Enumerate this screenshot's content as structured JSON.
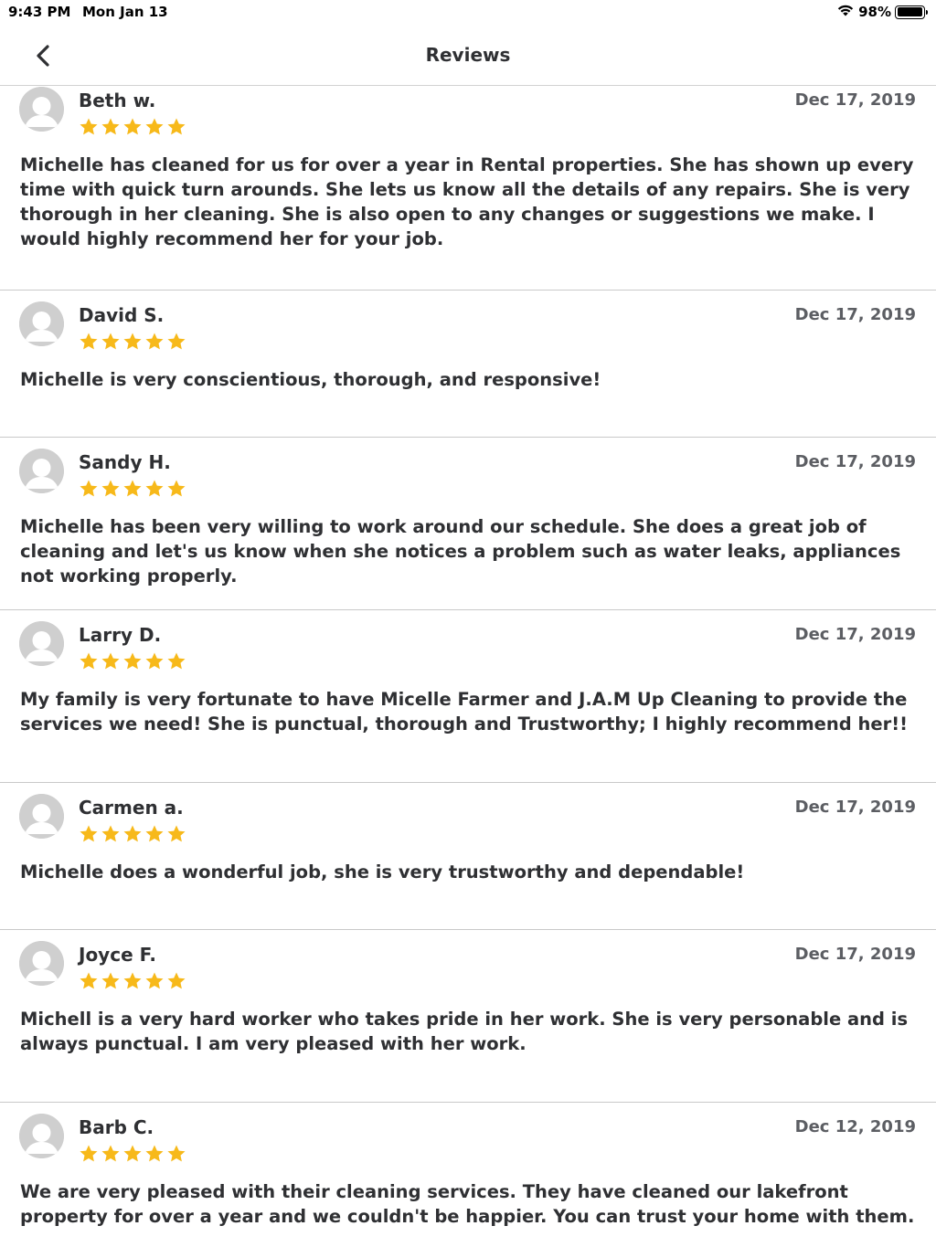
{
  "status_bar": {
    "time": "9:43 PM",
    "date": "Mon Jan 13",
    "battery_percent": "98%",
    "battery_level": 0.98,
    "wifi_icon": "wifi-icon"
  },
  "nav": {
    "title": "Reviews",
    "back_icon": "chevron-left-icon"
  },
  "star_color": "#f7b91a",
  "reviews": [
    {
      "name": "Beth w.",
      "date": "Dec 17, 2019",
      "rating": 5,
      "text": "Michelle has cleaned for us for over a year in Rental properties.  She has shown up every time with quick turn arounds. She lets us know all the details of any repairs.  She is very thorough in her cleaning.  She is also open to any changes or suggestions we make.  I would highly recommend her for your job."
    },
    {
      "name": "David S.",
      "date": "Dec 17, 2019",
      "rating": 5,
      "text": "Michelle is very conscientious, thorough, and responsive!"
    },
    {
      "name": "Sandy H.",
      "date": "Dec 17, 2019",
      "rating": 5,
      "text": "Michelle has been very willing to work around our schedule.  She does a great job of cleaning and let's us know when she notices a  problem such as water leaks, appliances not working properly."
    },
    {
      "name": "Larry D.",
      "date": "Dec 17, 2019",
      "rating": 5,
      "text": "My family is very fortunate to have Micelle Farmer and J.A.M Up Cleaning to provide the services we need! She is punctual, thorough and Trustworthy; I highly recommend her!!"
    },
    {
      "name": "Carmen a.",
      "date": "Dec 17, 2019",
      "rating": 5,
      "text": "Michelle does a wonderful job, she is very trustworthy and dependable!"
    },
    {
      "name": "Joyce F.",
      "date": "Dec 17, 2019",
      "rating": 5,
      "text": "Michell is a very hard worker who takes pride in her work. She is very personable and is always punctual. I am very pleased with her work."
    },
    {
      "name": "Barb C.",
      "date": "Dec 12, 2019",
      "rating": 5,
      "text": "We are very pleased with their cleaning services.  They have cleaned our lakefront property for over a year and we couldn't be happier.  You can trust your home with them."
    }
  ]
}
